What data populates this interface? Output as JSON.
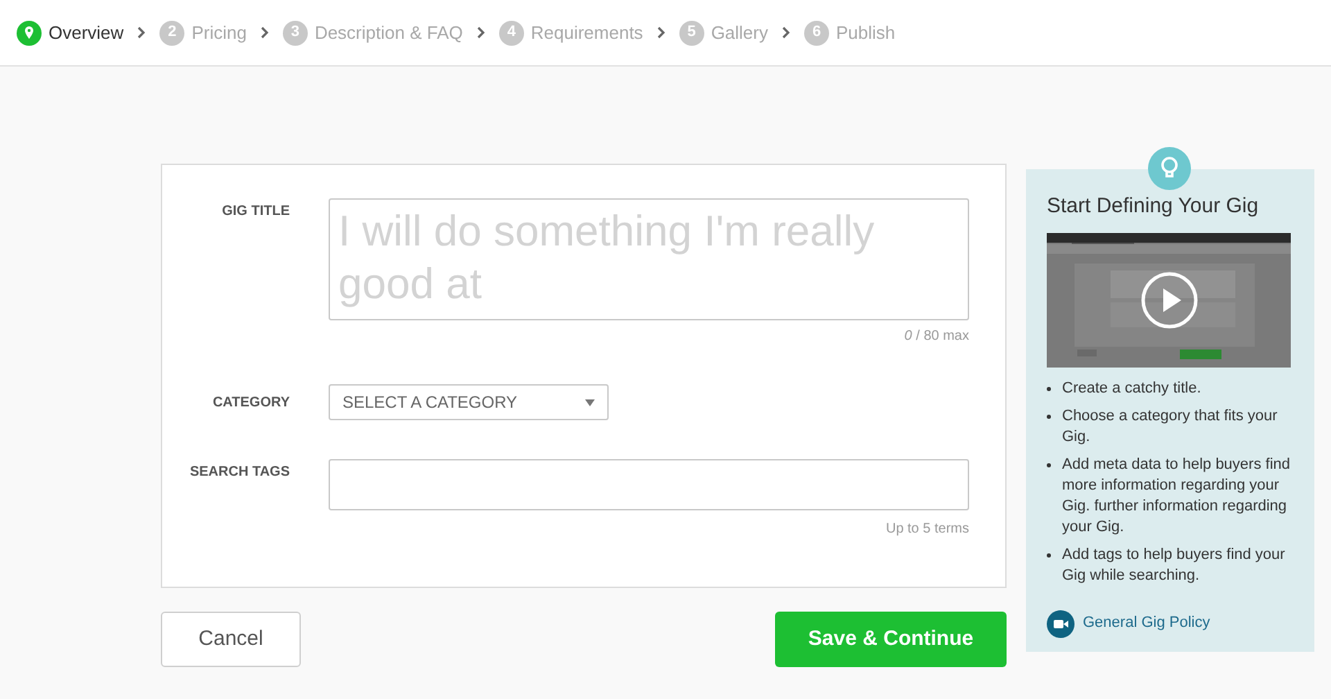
{
  "steps": [
    {
      "label": "Overview",
      "selected": true
    },
    {
      "number": "2",
      "label": "Pricing",
      "selected": false
    },
    {
      "number": "3",
      "label": "Description & FAQ",
      "selected": false
    },
    {
      "number": "4",
      "label": "Requirements",
      "selected": false
    },
    {
      "number": "5",
      "label": "Gallery",
      "selected": false
    },
    {
      "number": "6",
      "label": "Publish",
      "selected": false
    }
  ],
  "form": {
    "gig_title": {
      "label": "GIG TITLE",
      "placeholder": "I will do something I'm really good at",
      "counter": "*0* / 80 max"
    },
    "category": {
      "label": "CATEGORY",
      "value": "SELECT A CATEGORY"
    },
    "search_tags": {
      "label": "SEARCH TAGS",
      "hint": "Up to 5 terms"
    }
  },
  "buttons": {
    "cancel": "Cancel",
    "save": "Save & Continue"
  },
  "sidebar": {
    "title": "Start Defining Your Gig",
    "tips": [
      "Create a catchy title.",
      "Choose a category that fits your Gig.",
      "Add meta data to help buyers find more information regarding your Gig. further information regarding your Gig.",
      "Add tags to help buyers find your Gig while searching."
    ],
    "link": "General Gig Policy"
  }
}
